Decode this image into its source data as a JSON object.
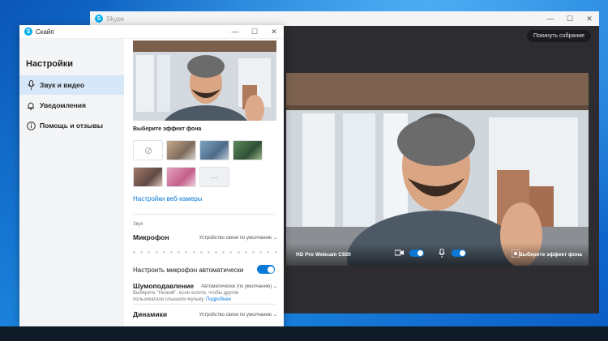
{
  "background_window": {
    "title": "Skype",
    "rejoin_button": "Покинуть собрание",
    "camera_label": "HD Pro Webcam C920",
    "effect_label": "Выберите эффект фона",
    "window_controls": [
      "—",
      "☐",
      "✕"
    ]
  },
  "dialog": {
    "title": "Скайп",
    "window_controls": [
      "—",
      "☐",
      "✕"
    ]
  },
  "sidebar": {
    "heading": "Настройки",
    "items": [
      {
        "label": "Звук и видео",
        "icon": "microphone-icon",
        "active": true
      },
      {
        "label": "Уведомления",
        "icon": "bell-icon",
        "active": false
      },
      {
        "label": "Помощь и отзывы",
        "icon": "info-icon",
        "active": false
      }
    ]
  },
  "video": {
    "effect_title": "Выберите эффект фона",
    "webcam_settings_link": "Настройки веб-камеры"
  },
  "audio": {
    "section_label": "Звук",
    "microphone_label": "Микрофон",
    "microphone_value": "Устройство связи по умолчанию",
    "auto_mic_label": "Настроить микрофон автоматически",
    "auto_mic_enabled": true,
    "noise_label": "Шумоподавление",
    "noise_value": "Автоматически (по умолчанию)",
    "noise_note": "Выберите \"Низкий\", если хотите, чтобы другие пользователи слышали музыку.",
    "noise_note_link": "Подробнее",
    "speakers_label": "Динамики",
    "speakers_value": "Устройство связи по умолчанию"
  },
  "colors": {
    "accent": "#0a78d6",
    "sidebar_active": "#d6e7f8",
    "sidebar_bg": "#f3f5f7",
    "call_bg": "#2c2c31",
    "desktop": "#1478d8"
  }
}
